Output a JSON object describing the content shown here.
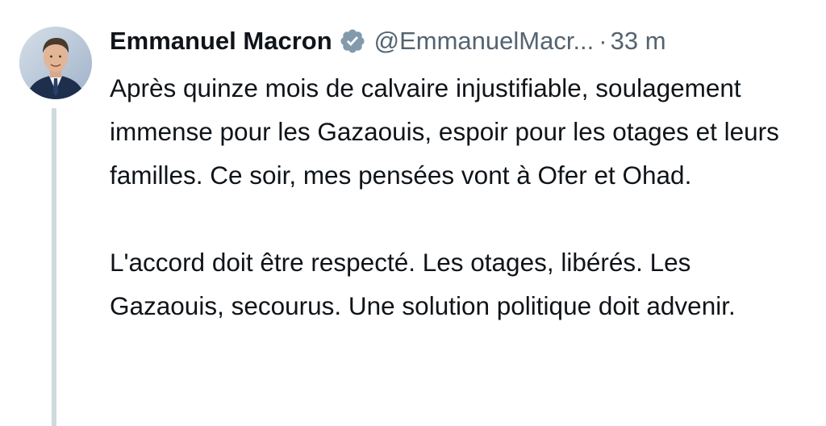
{
  "author": {
    "display_name": "Emmanuel Macron",
    "handle": "@EmmanuelMacr...",
    "verified_icon": "verified-badge-icon",
    "avatar": "profile-photo"
  },
  "meta": {
    "separator": "·",
    "time": "33 m"
  },
  "tweet": {
    "paragraph_1": "Après quinze mois de calvaire injustifiable, soulagement immense pour les Gazaouis, espoir pour les otages et leurs familles. Ce soir, mes pensées vont à Ofer et Ohad.",
    "paragraph_2": "L'accord doit être respecté. Les otages, libérés. Les Gazaouis, secourus. Une solution politique doit advenir."
  },
  "colors": {
    "text": "#0f1419",
    "secondary": "#536471",
    "verified_badge": "#829aab",
    "thread_line": "#cfd9de"
  }
}
